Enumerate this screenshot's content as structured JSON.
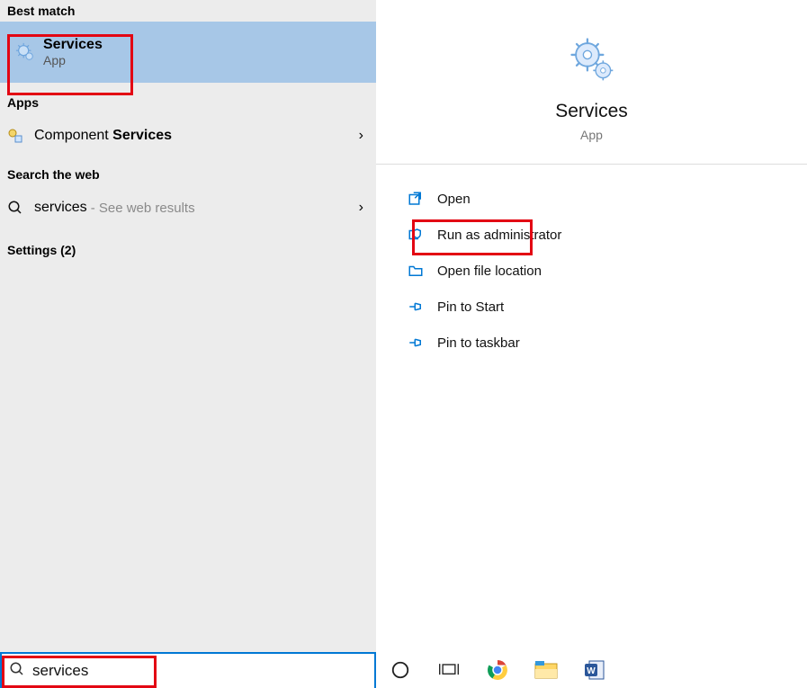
{
  "left": {
    "best_match_header": "Best match",
    "best_match": {
      "title": "Services",
      "subtitle": "App"
    },
    "apps_header": "Apps",
    "apps": [
      {
        "prefix": "Component ",
        "bold": "Services"
      }
    ],
    "web_header": "Search the web",
    "web": {
      "query": "services",
      "suffix": " - See web results"
    },
    "settings_header": "Settings (2)"
  },
  "right": {
    "title": "Services",
    "category": "App",
    "actions": {
      "open": "Open",
      "run_admin": "Run as administrator",
      "open_location": "Open file location",
      "pin_start": "Pin to Start",
      "pin_taskbar": "Pin to taskbar"
    }
  },
  "search": {
    "value": "services"
  }
}
